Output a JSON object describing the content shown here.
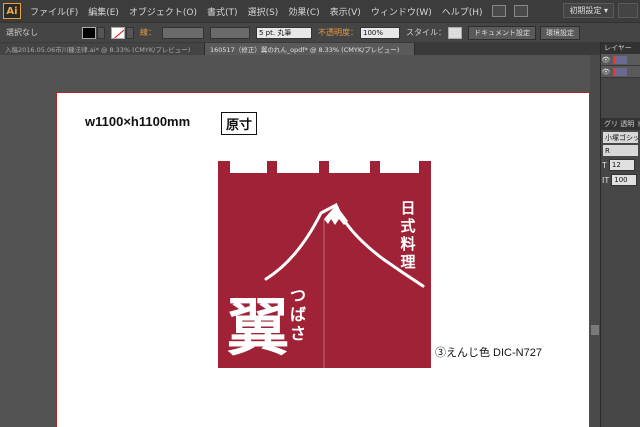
{
  "app": {
    "logo": "Ai"
  },
  "menu": {
    "items": [
      "ファイル(F)",
      "編集(E)",
      "オブジェクト(O)",
      "書式(T)",
      "選択(S)",
      "効果(C)",
      "表示(V)",
      "ウィンドウ(W)",
      "ヘルプ(H)"
    ],
    "workspace": "初期設定"
  },
  "control": {
    "selection": "選択なし",
    "stroke_label": "線：",
    "brush": "5 pt. 丸筆",
    "opacity_label": "不透明度：",
    "opacity_value": "100%",
    "style_label": "スタイル：",
    "doc_settings": "ドキュメント設定",
    "env_settings": "環境設定"
  },
  "tabs": [
    {
      "label": "入稿2016.05.06市川糠法律.ai* @ 8.33% (CMYK/プレビュー)",
      "active": false
    },
    {
      "label": "160517（修正）翼のれん_opdf* @ 8.33% (CMYK/プレビュー)",
      "active": true
    }
  ],
  "artboard": {
    "size": "w1100×h1100mm",
    "original_size": "原寸",
    "color_note": "③えんじ色 DIC-N727",
    "noren_color": "#9f2236",
    "vertical_title": [
      "日",
      "式",
      "料",
      "理"
    ],
    "kanji_main": "翼",
    "kana_side": [
      "つ",
      "ば",
      "さ"
    ]
  },
  "panels": {
    "layers_title": "レイヤー",
    "glyph_title": "グリ 透明 ド",
    "font_name": "小塚ゴシック",
    "font_style": "R",
    "font_size": "12",
    "leading": "100"
  },
  "colors": {
    "accent": "#e89a3a",
    "artboard_border": "#b0262d"
  }
}
